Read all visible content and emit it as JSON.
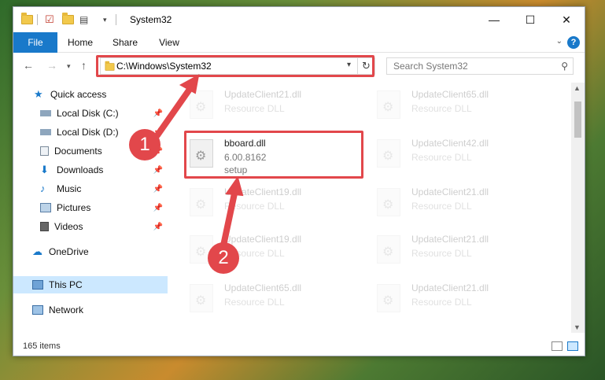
{
  "window": {
    "title": "System32",
    "controls": {
      "minimize": "—",
      "maximize": "☐",
      "close": "✕"
    }
  },
  "ribbon": {
    "tabs": [
      "File",
      "Home",
      "Share",
      "View"
    ],
    "help": "?"
  },
  "navigation": {
    "back_icon": "back-arrow-icon",
    "forward_icon": "forward-arrow-icon",
    "up_icon": "up-arrow-icon",
    "address": "C:\\Windows\\System32",
    "search_placeholder": "Search System32"
  },
  "sidebar": {
    "items": [
      {
        "label": "Quick access",
        "icon": "star-icon"
      },
      {
        "label": "Local Disk (C:)",
        "icon": "drive-icon",
        "pinned": true
      },
      {
        "label": "Local Disk (D:)",
        "icon": "drive-icon",
        "pinned": true
      },
      {
        "label": "Documents",
        "icon": "documents-icon",
        "pinned": true
      },
      {
        "label": "Downloads",
        "icon": "downloads-icon",
        "pinned": true
      },
      {
        "label": "Music",
        "icon": "music-icon",
        "pinned": true
      },
      {
        "label": "Pictures",
        "icon": "pictures-icon",
        "pinned": true
      },
      {
        "label": "Videos",
        "icon": "videos-icon",
        "pinned": true
      },
      {
        "label": "OneDrive",
        "icon": "cloud-icon"
      },
      {
        "label": "This PC",
        "icon": "pc-icon",
        "selected": true
      },
      {
        "label": "Network",
        "icon": "network-icon"
      }
    ]
  },
  "files": [
    {
      "name": "UpdateClient21.dll",
      "type": "Resource DLL"
    },
    {
      "name": "UpdateClient65.dll",
      "type": "Resource DLL"
    },
    {
      "name": "bboard.dll",
      "version": "6.00.8162",
      "type": "setup"
    },
    {
      "name": "UpdateClient42.dll",
      "type": "Resource DLL"
    },
    {
      "name": "UpdateClient19.dll",
      "type": "Resource DLL"
    },
    {
      "name": "UpdateClient21.dll",
      "type": "Resource DLL"
    },
    {
      "name": "UpdateClient19.dll",
      "type": "Resource DLL"
    },
    {
      "name": "UpdateClient21.dll",
      "type": "Resource DLL"
    },
    {
      "name": "UpdateClient65.dll",
      "type": "Resource DLL"
    },
    {
      "name": "UpdateClient21.dll",
      "type": "Resource DLL"
    }
  ],
  "status": {
    "item_count": "165 items"
  },
  "callouts": [
    "1",
    "2"
  ],
  "colors": {
    "accent": "#1979ca",
    "highlight": "#e2474b",
    "selection": "#cce8ff"
  }
}
